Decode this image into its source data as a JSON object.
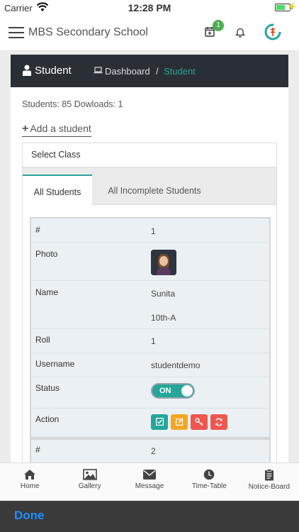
{
  "status_bar": {
    "carrier": "Carrier",
    "time": "12:28 PM",
    "charge_glyph": "⚡"
  },
  "app_bar": {
    "title": "MBS Secondary School",
    "notification_count": "1",
    "icons": [
      "menu-icon",
      "calendar-icon",
      "bell-icon",
      "school-logo"
    ]
  },
  "page_header": {
    "title": "Student",
    "breadcrumb": {
      "dashboard": "Dashboard",
      "separator": "/",
      "current": "Student"
    }
  },
  "stats": "Students: 85 Dowloads: 1",
  "add_student": {
    "icon": "+",
    "label": "Add a student"
  },
  "select_class": "Select Class",
  "tabs": [
    {
      "label": "All Students",
      "active": true
    },
    {
      "label": "All Incomplete Students",
      "active": false
    }
  ],
  "records": [
    {
      "number_label": "#",
      "number": "1",
      "photo_label": "Photo",
      "name_label": "Name",
      "name": "Sunita",
      "class": "10th-A",
      "roll_label": "Roll",
      "roll": "1",
      "username_label": "Username",
      "username": "studentdemo",
      "status_label": "Status",
      "status": "ON",
      "action_label": "Action",
      "actions": [
        {
          "icon": "check-icon",
          "color": "#26a69a"
        },
        {
          "icon": "edit-icon",
          "color": "#f5a623"
        },
        {
          "icon": "key-icon",
          "color": "#f0564e"
        },
        {
          "icon": "refresh-icon",
          "color": "#f0564e"
        }
      ]
    },
    {
      "number_label": "#",
      "number": "2"
    }
  ],
  "bottom_tabs": [
    {
      "label": "Home",
      "icon": "home-icon"
    },
    {
      "label": "Gallery",
      "icon": "gallery-icon"
    },
    {
      "label": "Message",
      "icon": "message-icon"
    },
    {
      "label": "Time-Table",
      "icon": "clock-icon"
    },
    {
      "label": "Notice-Board",
      "icon": "clipboard-icon"
    }
  ],
  "done": "Done",
  "colors": {
    "accent": "#26a69a",
    "header_bg": "#2a2f35",
    "badge": "#4caf50",
    "link_blue": "#1e90ff"
  }
}
